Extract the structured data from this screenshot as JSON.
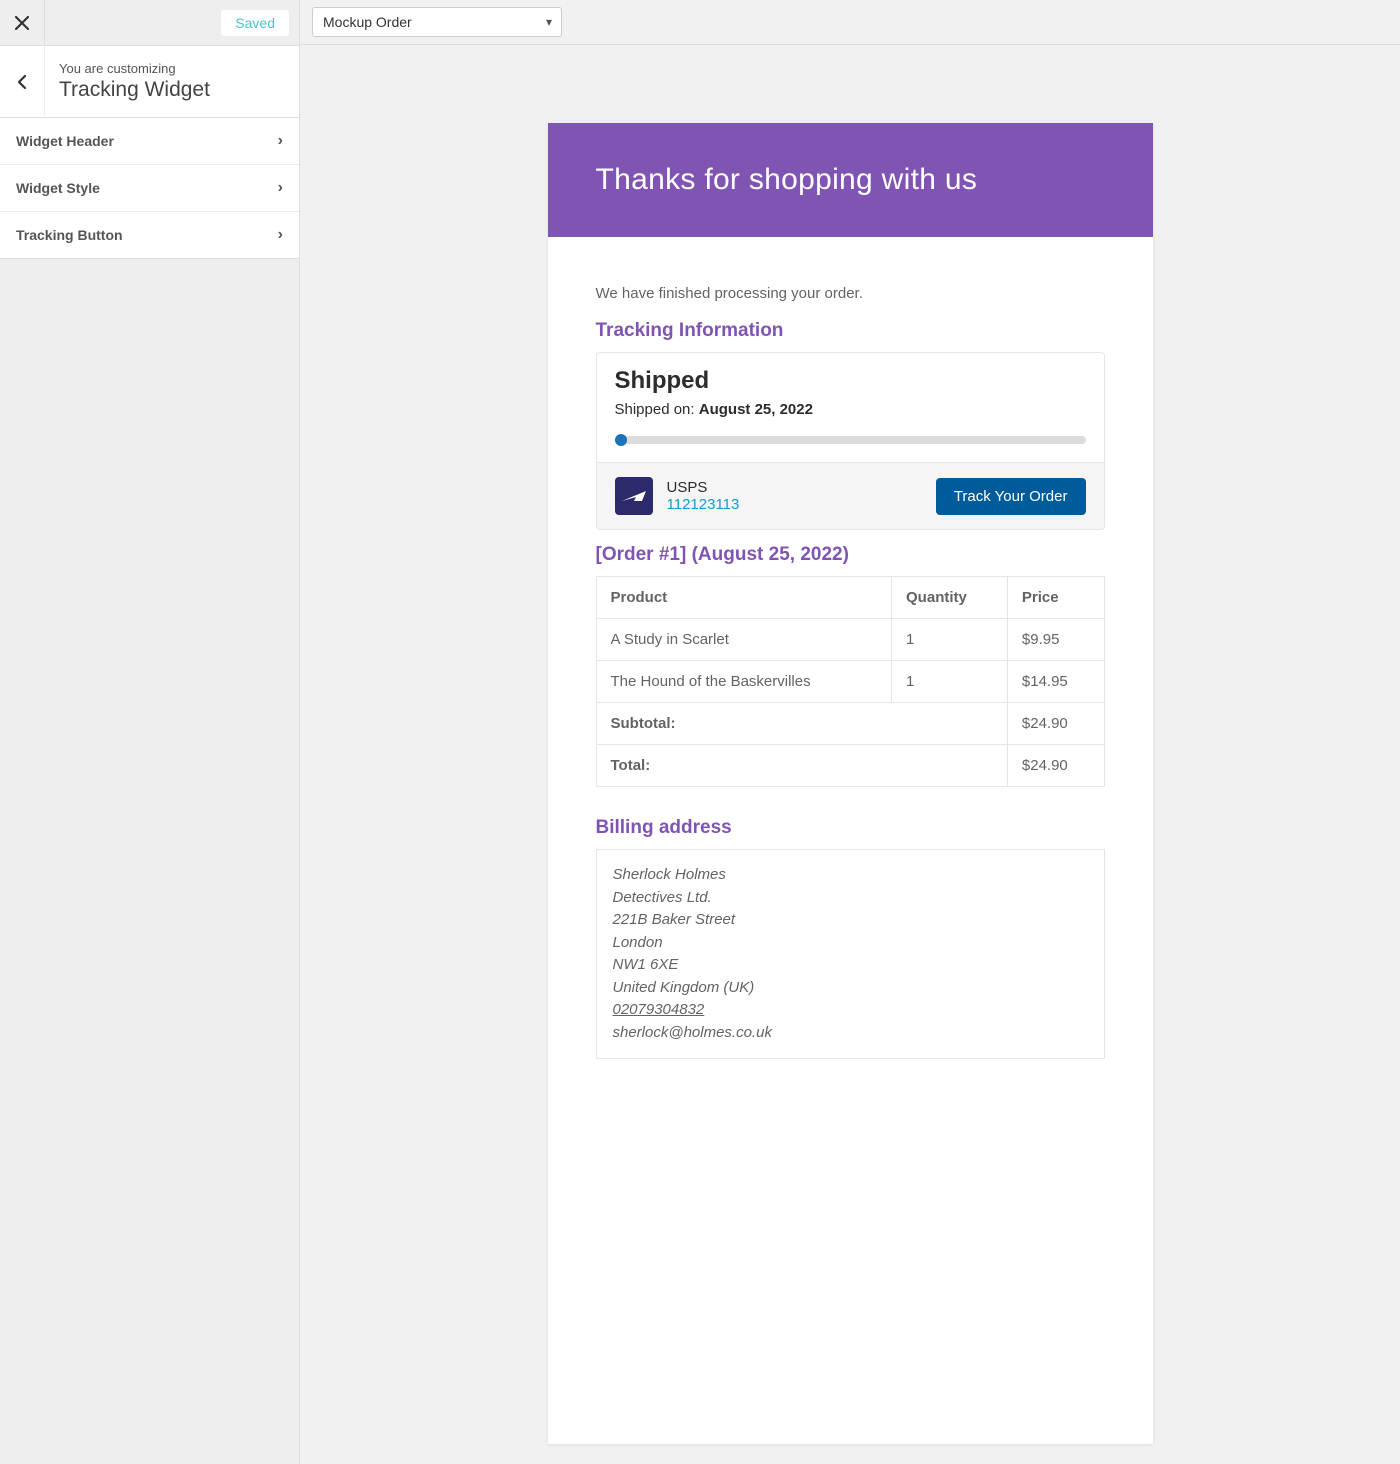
{
  "sidebar": {
    "saved_label": "Saved",
    "supertitle": "You are customizing",
    "title": "Tracking Widget",
    "menu": [
      {
        "label": "Widget Header"
      },
      {
        "label": "Widget Style"
      },
      {
        "label": "Tracking Button"
      }
    ]
  },
  "topbar": {
    "order_select": "Mockup Order"
  },
  "email": {
    "header_title": "Thanks for shopping with us",
    "intro": "We have finished processing your order.",
    "tracking_heading": "Tracking Information",
    "status_title": "Shipped",
    "shipped_on_label": "Shipped on:",
    "shipped_on_date": "August 25, 2022",
    "carrier_name": "USPS",
    "tracking_number": "112123113",
    "track_button": "Track Your Order",
    "order_heading": "[Order #1] (August 25, 2022)",
    "table_headers": {
      "product": "Product",
      "quantity": "Quantity",
      "price": "Price"
    },
    "items": [
      {
        "product": "A Study in Scarlet",
        "qty": "1",
        "price": "$9.95"
      },
      {
        "product": "The Hound of the Baskervilles",
        "qty": "1",
        "price": "$14.95"
      }
    ],
    "subtotal_label": "Subtotal:",
    "subtotal_value": "$24.90",
    "total_label": "Total:",
    "total_value": "$24.90",
    "billing_heading": "Billing address",
    "billing": {
      "name": "Sherlock Holmes",
      "company": "Detectives Ltd.",
      "street": "221B Baker Street",
      "city": "London",
      "postcode": "NW1 6XE",
      "country": "United Kingdom (UK)",
      "phone": "02079304832",
      "email": "sherlock@holmes.co.uk"
    }
  },
  "colors": {
    "accent": "#7f54b3",
    "button": "#005b9a"
  }
}
